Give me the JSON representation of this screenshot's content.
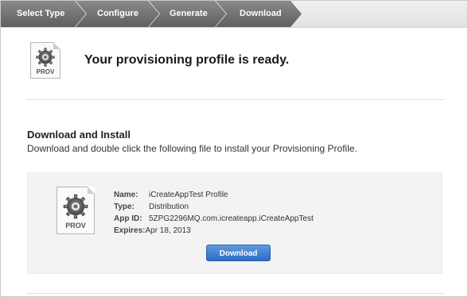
{
  "steps": [
    {
      "label": "Select Type"
    },
    {
      "label": "Configure"
    },
    {
      "label": "Generate"
    },
    {
      "label": "Download"
    }
  ],
  "header": {
    "icon": "provisioning-profile-icon",
    "icon_label": "PROV",
    "title": "Your provisioning profile is ready."
  },
  "section": {
    "title": "Download and Install",
    "description": "Download and double click the following file to install your Provisioning Profile."
  },
  "profile": {
    "icon": "provisioning-profile-icon",
    "icon_label": "PROV",
    "name_key": "Name:",
    "name_value": "iCreateAppTest Profile",
    "type_key": "Type:",
    "type_value": "Distribution",
    "appid_key": "App ID:",
    "appid_value": "5ZPG2296MQ.com.icreateapp.iCreateAppTest",
    "expires_key": "Expires:",
    "expires_value": "Apr 18, 2013",
    "download_label": "Download"
  },
  "colors": {
    "step_bar": "#6f6f6f",
    "button": "#2c6cc4",
    "panel": "#f3f3f3"
  }
}
